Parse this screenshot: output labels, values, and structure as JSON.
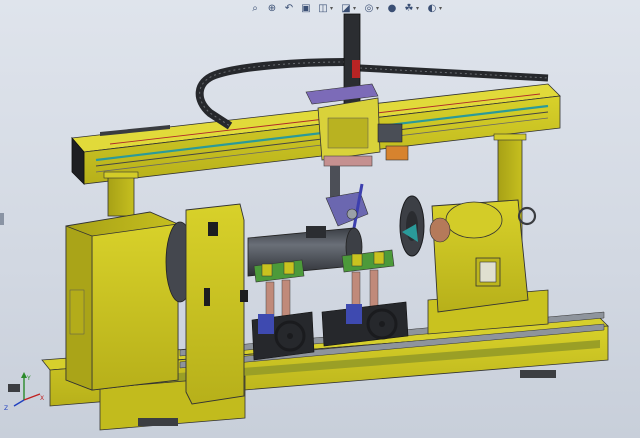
{
  "toolbar": {
    "buttons": [
      {
        "name": "zoom-to-fit",
        "icon": "zoom-fit-icon",
        "glyph": "⌕",
        "dropdown": false
      },
      {
        "name": "zoom-to-area",
        "icon": "zoom-area-icon",
        "glyph": "⊕",
        "dropdown": false
      },
      {
        "name": "previous-view",
        "icon": "previous-view-icon",
        "glyph": "↶",
        "dropdown": false
      },
      {
        "name": "section-view",
        "icon": "section-view-icon",
        "glyph": "▣",
        "dropdown": false
      },
      {
        "name": "view-orientation",
        "icon": "view-orientation-icon",
        "glyph": "◫",
        "dropdown": true
      },
      {
        "name": "display-style",
        "icon": "display-style-icon",
        "glyph": "◪",
        "dropdown": true
      },
      {
        "name": "hide-show-items",
        "icon": "hide-show-icon",
        "glyph": "◎",
        "dropdown": true
      },
      {
        "name": "edit-appearance",
        "icon": "appearance-icon",
        "glyph": "●",
        "dropdown": false
      },
      {
        "name": "apply-scene",
        "icon": "scene-icon",
        "glyph": "☘",
        "dropdown": true
      },
      {
        "name": "view-settings",
        "icon": "view-settings-icon",
        "glyph": "◐",
        "dropdown": true
      }
    ]
  },
  "triad": {
    "x": "X",
    "y": "Y",
    "z": "Z"
  },
  "colors": {
    "machine": "#c9c21f",
    "machine_dark": "#8f8a12",
    "steel": "#4a4f58",
    "rail": "#9aa0a8",
    "cable_chain": "#26282c",
    "background": "#d6dce5"
  }
}
